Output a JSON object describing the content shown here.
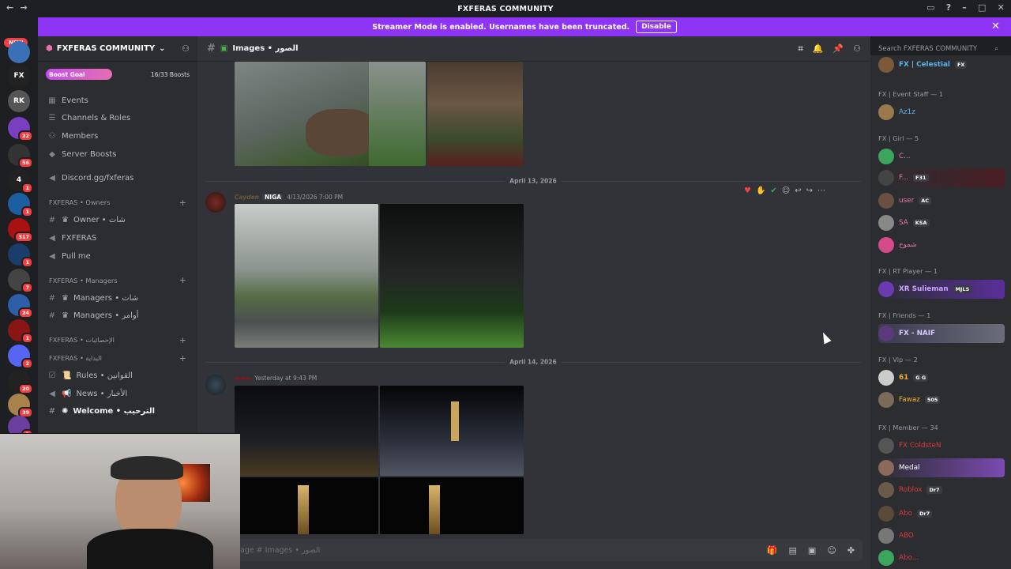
{
  "titlebar": {
    "title": "FXFERAS COMMUNITY"
  },
  "banner": {
    "text": "Streamer Mode is enabled. Usernames have been truncated.",
    "button": "Disable"
  },
  "servers": {
    "new_label": "NEW",
    "badges": [
      "",
      "",
      "",
      "22",
      "56",
      "1",
      "1",
      "317",
      "1",
      "7",
      "24",
      "1",
      "2",
      "20",
      "39",
      "3"
    ]
  },
  "sidebar": {
    "server_name": "FXFERAS COMMUNITY",
    "boost_label": "Boost Goal",
    "boost_count": "16/33 Boosts",
    "boost_fraction": 0.48,
    "items": [
      {
        "label": "Events"
      },
      {
        "label": "Channels & Roles"
      },
      {
        "label": "Members"
      },
      {
        "label": "Server Boosts"
      },
      {
        "label": "Discord.gg/fxferas"
      },
      {
        "label": "FXFERAS • Owners"
      },
      {
        "label": "Owner • شات"
      },
      {
        "label": "FXFERAS"
      },
      {
        "label": "Pull me"
      },
      {
        "label": "FXFERAS • Managers"
      },
      {
        "label": "Managers • شات"
      },
      {
        "label": "Managers • أوامر"
      },
      {
        "label": "FXFERAS • الإحصائيات"
      },
      {
        "label": "FXFERAS • البداية"
      },
      {
        "label": "Rules • القوانين"
      },
      {
        "label": "News • الأخبار"
      },
      {
        "label": "Welcome • الترحيب"
      }
    ]
  },
  "channel": {
    "name": "Images • الصور"
  },
  "search": {
    "placeholder": "Search FXFERAS COMMUNITY"
  },
  "messages": {
    "date1": "April 13, 2026",
    "msg1_author": "Cayden",
    "msg1_tag": "NIGA",
    "msg1_time": "4/13/2026 7:00 PM",
    "date2": "April 14, 2026",
    "msg2_time": "Yesterday at 9:43 PM"
  },
  "composer": {
    "placeholder": "Message #  Images • الصور"
  },
  "members": {
    "groups": [
      "FX | Event Staff — 1",
      "FX | Girl — 5",
      "FX | RT Player — 1",
      "FX | Friends — 1",
      "FX | Vip — 2",
      "FX | Member — 34"
    ],
    "list": [
      {
        "name": "FX | Celestial",
        "tag": "FX"
      },
      {
        "name": "Az1z",
        "tag": ""
      },
      {
        "name": "C...",
        "tag": ""
      },
      {
        "name": "F...",
        "tag": "F31"
      },
      {
        "name": "user",
        "tag": "AC"
      },
      {
        "name": "SA",
        "tag": "KSA"
      },
      {
        "name": "شموخ",
        "tag": ""
      },
      {
        "name": "XR Sulieman",
        "tag": "MJLS"
      },
      {
        "name": "FX - NAIF",
        "tag": ""
      },
      {
        "name": "61",
        "tag": "G G"
      },
      {
        "name": "Fawaz",
        "tag": "505"
      },
      {
        "name": "FX ColdsteN",
        "tag": ""
      },
      {
        "name": "Medal",
        "tag": ""
      },
      {
        "name": "Roblox",
        "tag": "Dr7"
      },
      {
        "name": "Abo",
        "tag": "Dr7"
      },
      {
        "name": "ABO",
        "tag": ""
      },
      {
        "name": "Abo...",
        "tag": ""
      }
    ]
  }
}
